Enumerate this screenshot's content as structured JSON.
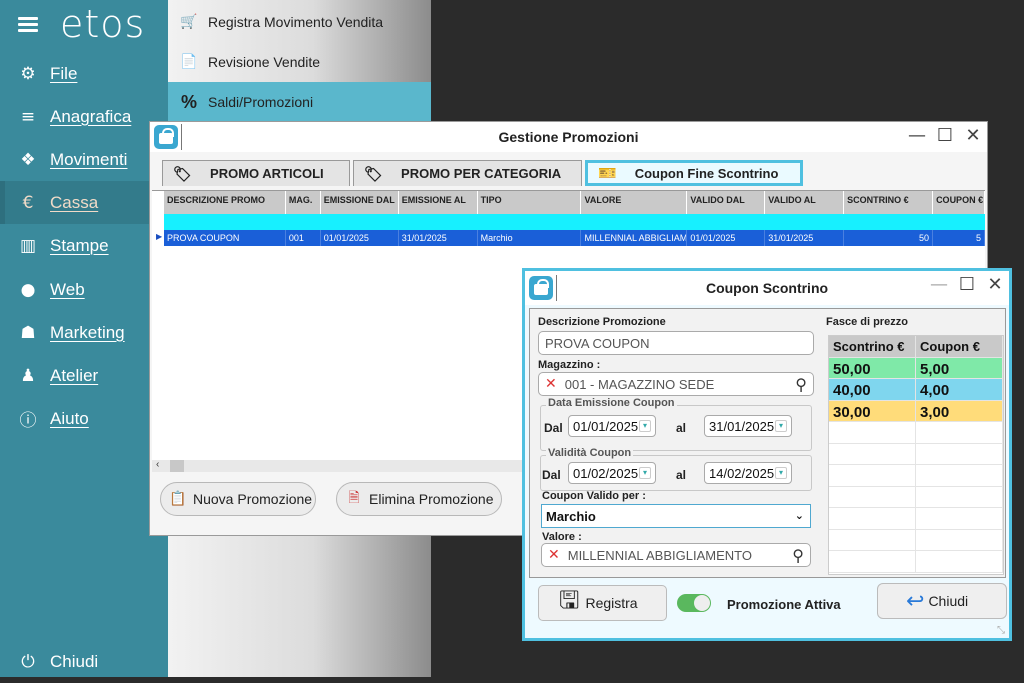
{
  "sidebar": {
    "logo": "etos",
    "items": [
      {
        "label": "File",
        "icon": "gear-icon",
        "glyph": "⚙"
      },
      {
        "label": "Anagrafica",
        "icon": "database-icon",
        "glyph": "≡"
      },
      {
        "label": "Movimenti",
        "icon": "cubes-icon",
        "glyph": "❖"
      },
      {
        "label": "Cassa",
        "icon": "euro-icon",
        "glyph": "€"
      },
      {
        "label": "Stampe",
        "icon": "bar-chart-icon",
        "glyph": "▥"
      },
      {
        "label": "Web",
        "icon": "globe-icon",
        "glyph": "●"
      },
      {
        "label": "Marketing",
        "icon": "users-icon",
        "glyph": "☗"
      },
      {
        "label": "Atelier",
        "icon": "person-icon",
        "glyph": "♟"
      },
      {
        "label": "Aiuto",
        "icon": "info-icon",
        "glyph": "ⓘ"
      }
    ],
    "close_label": "Chiudi",
    "close_glyph": "⏻"
  },
  "submenu": {
    "items": [
      {
        "label": "Registra Movimento Vendita",
        "glyph": "🛒",
        "color": "#f07c2a"
      },
      {
        "label": "Revisione Vendite",
        "glyph": "📄",
        "color": "#222222"
      },
      {
        "label": "Saldi/Promozioni",
        "glyph": "%",
        "color": "#222222"
      }
    ]
  },
  "gestione": {
    "title": "Gestione Promozioni",
    "tabs": [
      {
        "label": "PROMO ARTICOLI",
        "glyph": "🏷"
      },
      {
        "label": "PROMO PER CATEGORIA",
        "glyph": "🏷"
      },
      {
        "label": "Coupon Fine Scontrino",
        "glyph": "🎫"
      }
    ],
    "columns": [
      "DESCRIZIONE PROMO",
      "MAG.",
      "EMISSIONE DAL",
      "EMISSIONE AL",
      "TIPO",
      "VALORE",
      "VALIDO DAL",
      "VALIDO AL",
      "SCONTRINO €",
      "COUPON €"
    ],
    "rows": [
      [
        "PROVA COUPON",
        "001",
        "01/01/2025",
        "31/01/2025",
        "Marchio",
        "MILLENNIAL ABBIGLIAMENTO",
        "01/01/2025",
        "31/01/2025",
        "50",
        "5"
      ]
    ],
    "new_button": "Nuova Promozione",
    "delete_button": "Elimina Promozione"
  },
  "coupon": {
    "title": "Coupon Scontrino",
    "descrizione_label": "Descrizione Promozione",
    "descrizione_value": "PROVA COUPON",
    "magazzino_label": "Magazzino :",
    "magazzino_value": "001 - MAGAZZINO SEDE",
    "emissione_label": "Data Emissione Coupon",
    "validita_label": "Validità Coupon",
    "dal_label": "Dal",
    "al_label": "al",
    "emissione_dal": "01/01/2025",
    "emissione_al": "31/01/2025",
    "validita_dal": "01/02/2025",
    "validita_al": "14/02/2025",
    "valido_per_label": "Coupon Valido per :",
    "valido_per_value": "Marchio",
    "valore_label": "Valore :",
    "valore_value": "MILLENNIAL ABBIGLIAMENTO",
    "fasce_label": "Fasce di prezzo",
    "fasce_headers": [
      "Scontrino €",
      "Coupon €"
    ],
    "fasce": [
      {
        "scontrino": "50,00",
        "coupon": "5,00",
        "color": "#7fe9a8"
      },
      {
        "scontrino": "40,00",
        "coupon": "4,00",
        "color": "#7fd6ee"
      },
      {
        "scontrino": "30,00",
        "coupon": "3,00",
        "color": "#ffdc7a"
      }
    ],
    "registra_label": "Registra",
    "attiva_label": "Promozione Attiva",
    "chiudi_label": "Chiudi"
  }
}
